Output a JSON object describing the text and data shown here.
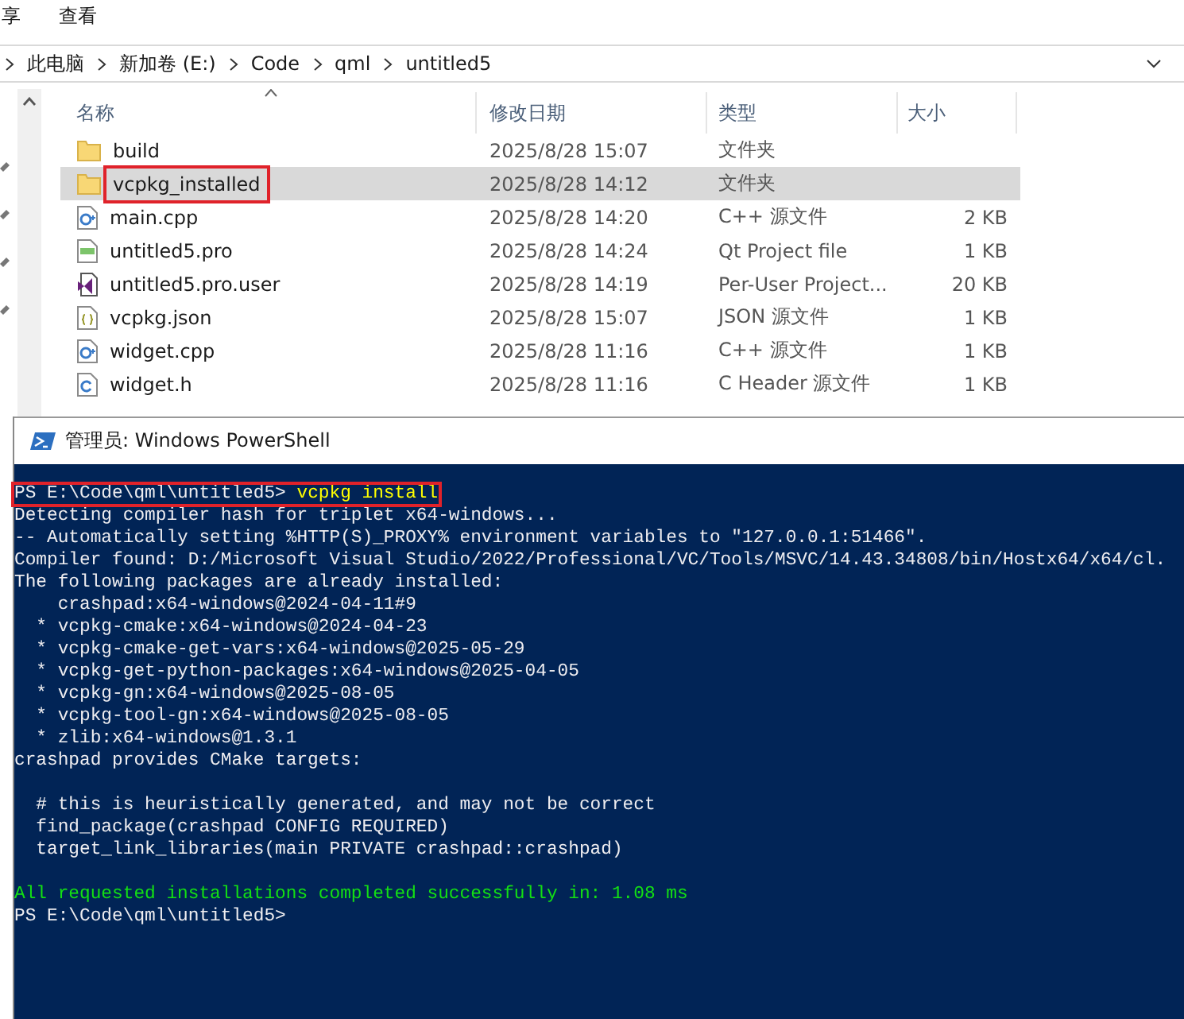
{
  "explorer": {
    "ribbon_tabs": [
      {
        "label": "享",
        "selected": false
      },
      {
        "label": "查看",
        "selected": false
      }
    ],
    "breadcrumb": [
      "此电脑",
      "新加卷 (E:)",
      "Code",
      "qml",
      "untitled5"
    ],
    "columns": [
      "名称",
      "修改日期",
      "类型",
      "大小"
    ],
    "files": [
      {
        "name": "build",
        "modified": "2025/8/28 15:07",
        "type": "文件夹",
        "kind": "folder",
        "selected": false,
        "highlighted": false
      },
      {
        "name": "vcpkg_installed",
        "modified": "2025/8/28 14:12",
        "type": "文件夹",
        "kind": "folder",
        "selected": true,
        "highlighted": true
      },
      {
        "name": "main.cpp",
        "modified": "2025/8/28 14:20",
        "type": "C++ 源文件",
        "size": "2 KB",
        "kind": "cpp",
        "selected": false,
        "highlighted": false
      },
      {
        "name": "untitled5.pro",
        "modified": "2025/8/28 14:24",
        "type": "Qt Project file",
        "size": "1 KB",
        "kind": "pro",
        "selected": false,
        "highlighted": false
      },
      {
        "name": "untitled5.pro.user",
        "modified": "2025/8/28 14:19",
        "type": "Per-User Project...",
        "size": "20 KB",
        "kind": "vsuser",
        "selected": false,
        "highlighted": false
      },
      {
        "name": "vcpkg.json",
        "modified": "2025/8/28 15:07",
        "type": "JSON 源文件",
        "size": "1 KB",
        "kind": "json",
        "selected": false,
        "highlighted": false
      },
      {
        "name": "widget.cpp",
        "modified": "2025/8/28 11:16",
        "type": "C++ 源文件",
        "size": "1 KB",
        "kind": "cpp",
        "selected": false,
        "highlighted": false
      },
      {
        "name": "widget.h",
        "modified": "2025/8/28 11:16",
        "type": "C Header 源文件",
        "size": "1 KB",
        "kind": "header",
        "selected": false,
        "highlighted": false
      }
    ]
  },
  "powershell": {
    "title": "管理员: Windows PowerShell",
    "lines": [
      {
        "kind": "command",
        "prompt": "PS E:\\Code\\qml\\untitled5> ",
        "command": "vcpkg install",
        "highlighted": true
      },
      {
        "kind": "output",
        "text": "Detecting compiler hash for triplet x64-windows..."
      },
      {
        "kind": "output",
        "text": "-- Automatically setting %HTTP(S)_PROXY% environment variables to \"127.0.0.1:51466\"."
      },
      {
        "kind": "output",
        "text": "Compiler found: D:/Microsoft Visual Studio/2022/Professional/VC/Tools/MSVC/14.43.34808/bin/Hostx64/x64/cl."
      },
      {
        "kind": "output",
        "text": "The following packages are already installed:"
      },
      {
        "kind": "output",
        "text": "    crashpad:x64-windows@2024-04-11#9"
      },
      {
        "kind": "output",
        "text": "  * vcpkg-cmake:x64-windows@2024-04-23"
      },
      {
        "kind": "output",
        "text": "  * vcpkg-cmake-get-vars:x64-windows@2025-05-29"
      },
      {
        "kind": "output",
        "text": "  * vcpkg-get-python-packages:x64-windows@2025-04-05"
      },
      {
        "kind": "output",
        "text": "  * vcpkg-gn:x64-windows@2025-08-05"
      },
      {
        "kind": "output",
        "text": "  * vcpkg-tool-gn:x64-windows@2025-08-05"
      },
      {
        "kind": "output",
        "text": "  * zlib:x64-windows@1.3.1"
      },
      {
        "kind": "output",
        "text": "crashpad provides CMake targets:"
      },
      {
        "kind": "blank"
      },
      {
        "kind": "output",
        "text": "  # this is heuristically generated, and may not be correct"
      },
      {
        "kind": "output",
        "text": "  find_package(crashpad CONFIG REQUIRED)"
      },
      {
        "kind": "output",
        "text": "  target_link_libraries(main PRIVATE crashpad::crashpad)"
      },
      {
        "kind": "blank"
      },
      {
        "kind": "success",
        "text": "All requested installations completed successfully in: 1.08 ms"
      },
      {
        "kind": "prompt",
        "prompt": "PS E:\\Code\\qml\\untitled5>"
      }
    ]
  }
}
